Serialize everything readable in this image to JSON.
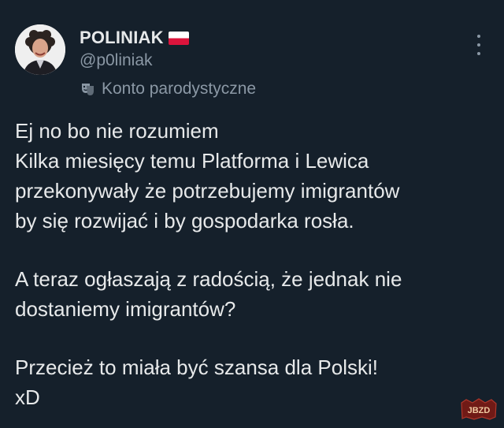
{
  "author": {
    "display_name": "POLINIAK",
    "flag_icon": "poland-flag-icon",
    "handle": "@p0liniak",
    "account_label": "Konto parodystyczne",
    "account_label_icon": "theater-masks-icon"
  },
  "tweet": {
    "lines_p1": [
      "Ej no bo nie rozumiem",
      "Kilka miesięcy temu Platforma i Lewica",
      "przekonywały że potrzebujemy imigrantów",
      "by się rozwijać i by gospodarka rosła."
    ],
    "lines_p2": [
      "A teraz ogłaszają z radością, że jednak nie",
      "dostaniemy imigrantów?"
    ],
    "lines_p3": [
      "Przecież to miała być szansa dla Polski!",
      "xD"
    ]
  },
  "watermark": {
    "text": "JBZD"
  },
  "colors": {
    "background": "#15202b",
    "text_primary": "#e7e9ea",
    "text_secondary": "#8b98a5",
    "flag_red": "#dc143c",
    "watermark": "#c0392b"
  }
}
